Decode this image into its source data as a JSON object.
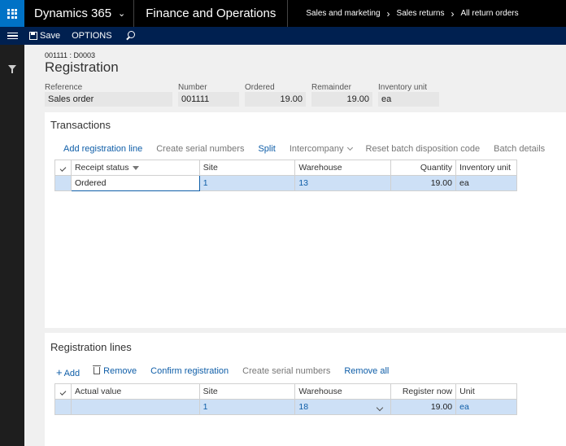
{
  "topbar": {
    "app_name": "Dynamics 365",
    "module": "Finance and Operations",
    "breadcrumbs": [
      "Sales and marketing",
      "Sales returns",
      "All return orders"
    ]
  },
  "actionbar": {
    "save_label": "Save",
    "options_label": "OPTIONS"
  },
  "page": {
    "record_id": "001111 : D0003",
    "title": "Registration"
  },
  "fields": [
    {
      "label": "Reference",
      "value": "Sales order"
    },
    {
      "label": "Number",
      "value": "001111"
    },
    {
      "label": "Ordered",
      "value": "19.00"
    },
    {
      "label": "Remainder",
      "value": "19.00"
    },
    {
      "label": "Inventory unit",
      "value": "ea"
    }
  ],
  "transactions": {
    "title": "Transactions",
    "toolbar": {
      "add_registration_line": "Add registration line",
      "create_serial_numbers": "Create serial numbers",
      "split": "Split",
      "intercompany": "Intercompany",
      "reset_batch_disposition_code": "Reset batch disposition code",
      "batch_details": "Batch details"
    },
    "columns": [
      "Receipt status",
      "Site",
      "Warehouse",
      "Quantity",
      "Inventory unit"
    ],
    "rows": [
      {
        "receipt_status": "Ordered",
        "site": "1",
        "warehouse": "13",
        "quantity": "19.00",
        "unit": "ea"
      }
    ]
  },
  "registration_lines": {
    "title": "Registration lines",
    "toolbar": {
      "add": "Add",
      "remove": "Remove",
      "confirm_registration": "Confirm registration",
      "create_serial_numbers": "Create serial numbers",
      "remove_all": "Remove all"
    },
    "columns": [
      "Actual value",
      "Site",
      "Warehouse",
      "Register now",
      "Unit"
    ],
    "rows": [
      {
        "actual_value": "",
        "site": "1",
        "warehouse": "18",
        "register_now": "19.00",
        "unit": "ea"
      }
    ]
  }
}
